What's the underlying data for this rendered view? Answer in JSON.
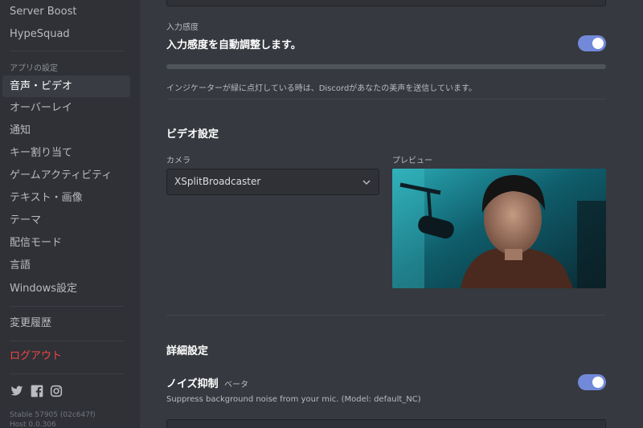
{
  "sidebar": {
    "items_top": [
      {
        "label": "Server Boost"
      },
      {
        "label": "HypeSquad"
      }
    ],
    "app_settings_header": "アプリの設定",
    "app_items": [
      {
        "label": "音声・ビデオ",
        "active": true
      },
      {
        "label": "オーバーレイ"
      },
      {
        "label": "通知"
      },
      {
        "label": "キー割り当て"
      },
      {
        "label": "ゲームアクティビティ"
      },
      {
        "label": "テキスト・画像"
      },
      {
        "label": "テーマ"
      },
      {
        "label": "配信モード"
      },
      {
        "label": "言語"
      },
      {
        "label": "Windows設定"
      }
    ],
    "changelog": "変更履歴",
    "logout": "ログアウト",
    "social_icons": [
      "twitter-icon",
      "facebook-icon",
      "instagram-icon"
    ],
    "version_line1": "Stable 57905 (02c647f)",
    "version_line2": "Host 0.0.306"
  },
  "input_sensitivity": {
    "label": "入力感度",
    "auto_label": "入力感度を自動調整します。",
    "auto_enabled": true,
    "description": "インジケーターが緑に点灯している時は、Discordがあなたの美声を送信しています。"
  },
  "video": {
    "title": "ビデオ設定",
    "camera_label": "カメラ",
    "camera_value": "XSplitBroadcaster",
    "preview_label": "プレビュー"
  },
  "advanced": {
    "title": "詳細設定",
    "noise_label": "ノイズ抑制",
    "noise_badge": "ベータ",
    "noise_enabled": true,
    "noise_description": "Suppress background noise from your mic. (Model: default_NC)"
  },
  "colors": {
    "accent": "#7289da",
    "danger": "#f04747",
    "background": "#36393f",
    "sidebar": "#2f3136"
  }
}
